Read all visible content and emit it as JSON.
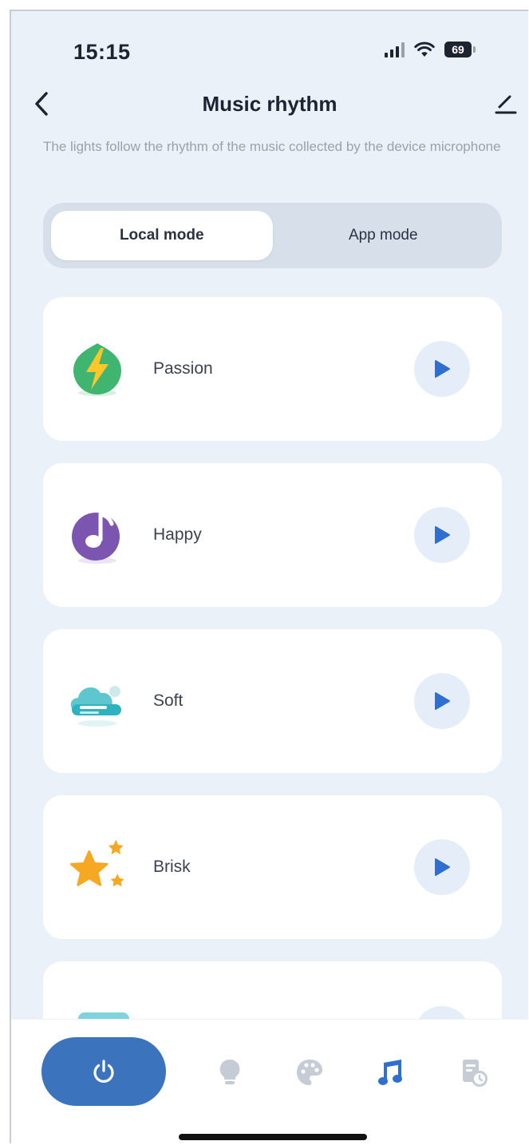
{
  "status_bar": {
    "time": "15:15",
    "battery": "69"
  },
  "header": {
    "title": "Music rhythm"
  },
  "description": "The lights follow the rhythm of the music collected by the device microphone",
  "modes": {
    "selected": "Local mode",
    "items": [
      {
        "label": "Local mode"
      },
      {
        "label": "App mode"
      }
    ]
  },
  "rhythms": [
    {
      "label": "Passion",
      "icon": "lightning-icon"
    },
    {
      "label": "Happy",
      "icon": "music-note-icon"
    },
    {
      "label": "Soft",
      "icon": "cloud-icon"
    },
    {
      "label": "Brisk",
      "icon": "stars-icon"
    }
  ],
  "colors": {
    "accent": "#3b73bd",
    "background": "#eaf1f8",
    "play_icon": "#2f6fd0"
  },
  "bottom_nav": {
    "items": [
      {
        "icon": "power-icon"
      },
      {
        "icon": "bulb-icon"
      },
      {
        "icon": "palette-icon"
      },
      {
        "icon": "music-icon",
        "active": true
      },
      {
        "icon": "schedule-icon"
      }
    ]
  }
}
